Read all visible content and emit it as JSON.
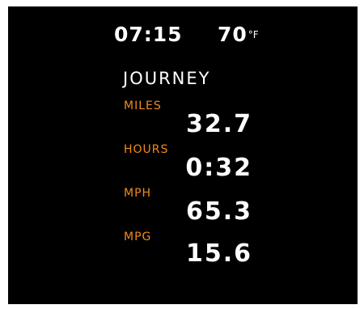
{
  "status": {
    "time": "07:15",
    "temperature": "70",
    "temperature_unit": "°F"
  },
  "journey": {
    "title": "JOURNEY",
    "stats": [
      {
        "label": "MILES",
        "value": "32.7"
      },
      {
        "label": "HOURS",
        "value": "0:32"
      },
      {
        "label": "MPH",
        "value": "65.3"
      },
      {
        "label": "MPG",
        "value": "15.6"
      }
    ]
  },
  "colors": {
    "background": "#000000",
    "label_accent": "#f28a1c",
    "value_text": "#ffffff"
  }
}
